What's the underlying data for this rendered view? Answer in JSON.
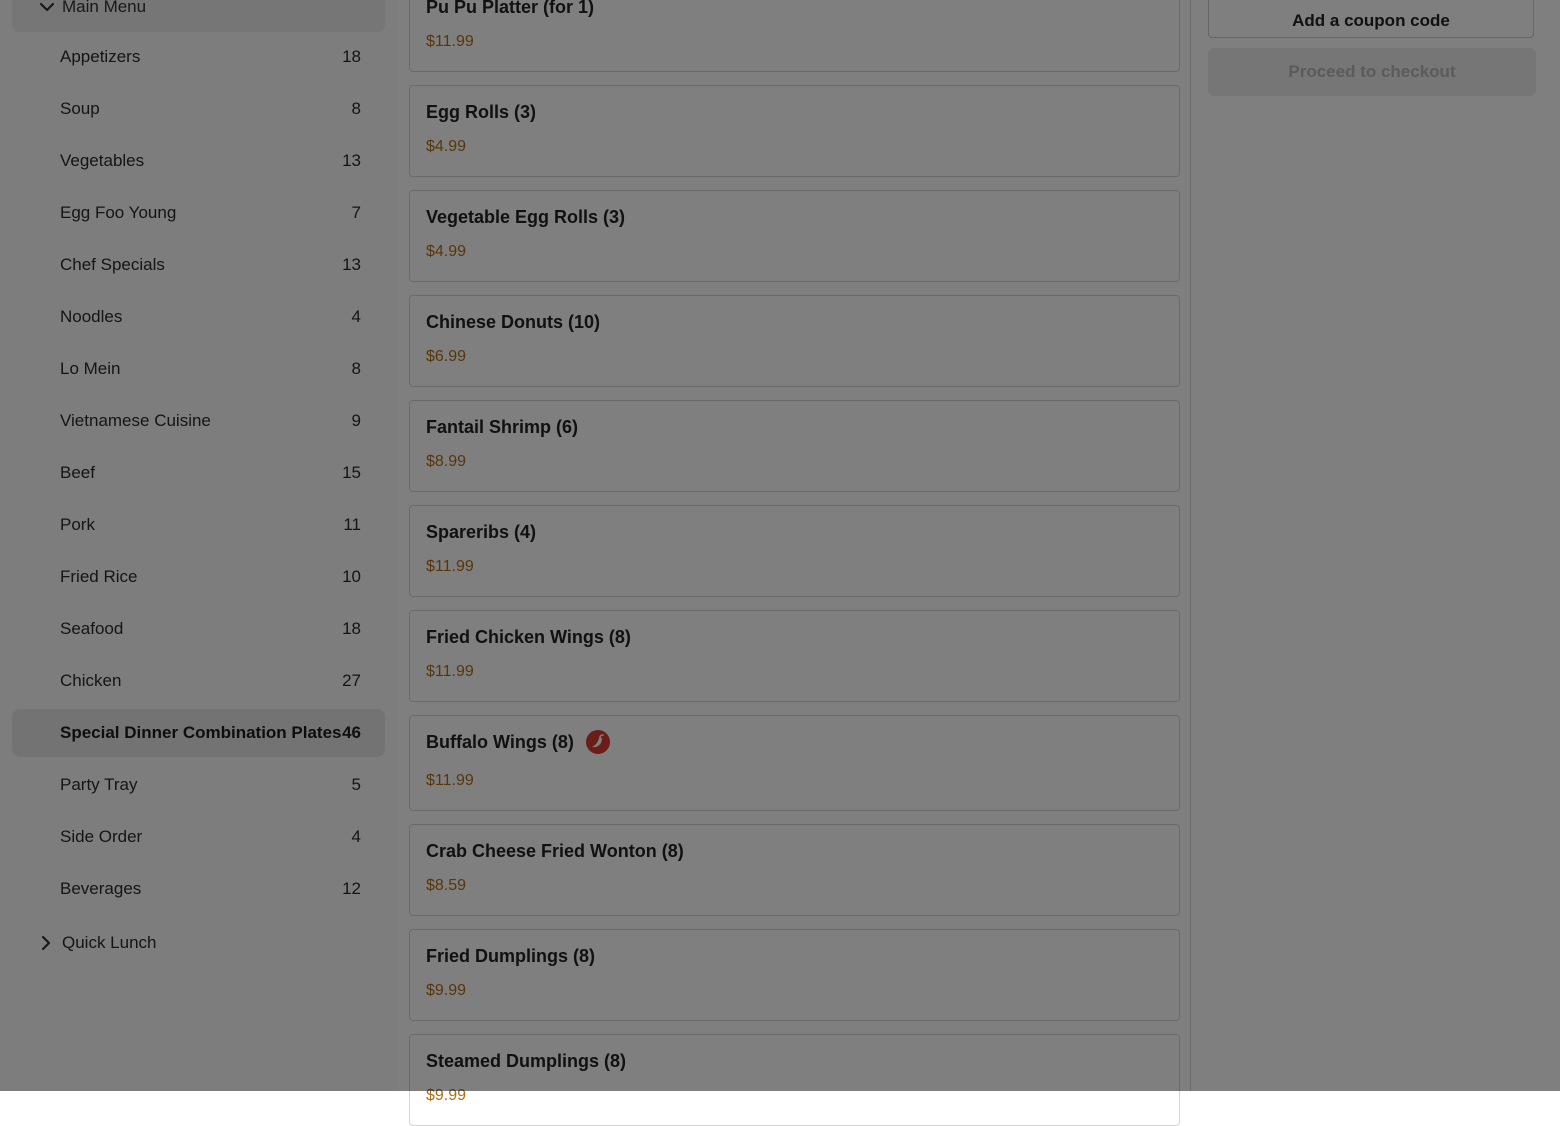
{
  "sidebar": {
    "main_menu_label": "Main Menu",
    "categories": [
      {
        "name": "Appetizers",
        "count": "18"
      },
      {
        "name": "Soup",
        "count": "8"
      },
      {
        "name": "Vegetables",
        "count": "13"
      },
      {
        "name": "Egg Foo Young",
        "count": "7"
      },
      {
        "name": "Chef Specials",
        "count": "13"
      },
      {
        "name": "Noodles",
        "count": "4"
      },
      {
        "name": "Lo Mein",
        "count": "8"
      },
      {
        "name": "Vietnamese Cuisine",
        "count": "9"
      },
      {
        "name": "Beef",
        "count": "15"
      },
      {
        "name": "Pork",
        "count": "11"
      },
      {
        "name": "Fried Rice",
        "count": "10"
      },
      {
        "name": "Seafood",
        "count": "18"
      },
      {
        "name": "Chicken",
        "count": "27"
      },
      {
        "name": "Special Dinner Combination Plates",
        "count": "46",
        "active": true
      },
      {
        "name": "Party Tray",
        "count": "5"
      },
      {
        "name": "Side Order",
        "count": "4"
      },
      {
        "name": "Beverages",
        "count": "12"
      }
    ],
    "quick_lunch_label": "Quick Lunch"
  },
  "menu_items": [
    {
      "name": "Pu Pu Platter (for 1)",
      "price": "$11.99"
    },
    {
      "name": "Egg Rolls (3)",
      "price": "$4.99"
    },
    {
      "name": "Vegetable Egg Rolls (3)",
      "price": "$4.99"
    },
    {
      "name": "Chinese Donuts (10)",
      "price": "$6.99"
    },
    {
      "name": "Fantail Shrimp (6)",
      "price": "$8.99"
    },
    {
      "name": "Spareribs (4)",
      "price": "$11.99"
    },
    {
      "name": "Fried Chicken Wings (8)",
      "price": "$11.99"
    },
    {
      "name": "Buffalo Wings (8)",
      "price": "$11.99",
      "spicy": true
    },
    {
      "name": "Crab Cheese Fried Wonton (8)",
      "price": "$8.59"
    },
    {
      "name": "Fried Dumplings (8)",
      "price": "$9.99"
    },
    {
      "name": "Steamed Dumplings (8)",
      "price": "$9.99"
    }
  ],
  "cart": {
    "coupon_label": "Add a coupon code",
    "checkout_label": "Proceed to checkout"
  },
  "icons": {
    "main_menu": "chevron-down-icon",
    "quick_lunch": "chevron-right-icon",
    "spicy": "chili-pepper-icon"
  },
  "colors": {
    "price": "#b06d12",
    "spicy_badge": "#d63a2e",
    "active_category_bg": "#e7e7e7",
    "overlay": "rgba(0,0,0,0.5)"
  }
}
